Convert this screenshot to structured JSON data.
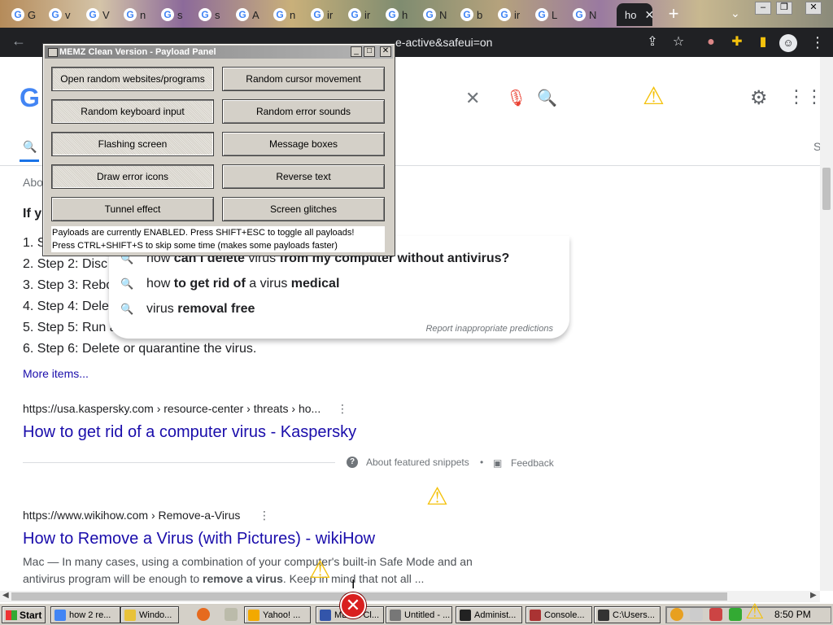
{
  "browser": {
    "tabs": [
      {
        "label": "G"
      },
      {
        "label": "v"
      },
      {
        "label": "V"
      },
      {
        "label": "n"
      },
      {
        "label": "s"
      },
      {
        "label": "s"
      },
      {
        "label": "A"
      },
      {
        "label": "n"
      },
      {
        "label": "ir"
      },
      {
        "label": "ir"
      },
      {
        "label": "h"
      },
      {
        "label": "N"
      },
      {
        "label": "b"
      },
      {
        "label": "ir"
      },
      {
        "label": "L"
      },
      {
        "label": "N"
      }
    ],
    "active_tab": "ho",
    "close_glyph": "✕",
    "new_tab_glyph": "+",
    "url_fragment": "e-active&safeui=on",
    "window_controls": [
      "–",
      "❐",
      "✕"
    ]
  },
  "google": {
    "logo_text": "G",
    "about_text": "Abo",
    "heading_text": "If y",
    "s_tab": "S",
    "steps": [
      "1. S",
      "2. Step 2: Disc",
      "3. Step 3: Rebo",
      "4. Step 4: Dele",
      "5. Step 5: Run a",
      "6. Step 6: Delete or quarantine the virus."
    ],
    "more_items": "More items...",
    "autocomplete": [
      {
        "pre": "how ",
        "bold": "can i delete",
        "mid": " virus ",
        "bold2": "from my computer without antivirus?"
      },
      {
        "pre": "how ",
        "bold": "to get rid of",
        "mid": " a virus ",
        "bold2": "medical"
      },
      {
        "pre": "virus ",
        "bold": "removal free",
        "mid": "",
        "bold2": ""
      }
    ],
    "report_predictions": "Report inappropriate predictions",
    "result1": {
      "url": "https://usa.kaspersky.com › resource-center › threats › ho...",
      "title": "How to get rid of a computer virus - Kaspersky"
    },
    "featured": {
      "about": "About featured snippets",
      "dot": "•",
      "feedback": "Feedback"
    },
    "result2": {
      "url": "https://www.wikihow.com › Remove-a-Virus",
      "title": "How to Remove a Virus (with Pictures) - wikiHow",
      "snippet_pre": "Mac — In many cases, using a combination of your computer's built-in Safe Mode and an antivirus program will be enough to ",
      "snippet_bold": "remove a virus",
      "snippet_post": ". Keep in mind that not all ..."
    }
  },
  "memz": {
    "title": "MEMZ Clean Version - Payload Panel",
    "buttons": [
      {
        "label": "Open random websites/programs",
        "enabled": true
      },
      {
        "label": "Random cursor movement",
        "enabled": false
      },
      {
        "label": "Random keyboard input",
        "enabled": true
      },
      {
        "label": "Random error sounds",
        "enabled": false
      },
      {
        "label": "Flashing screen",
        "enabled": true
      },
      {
        "label": "Message boxes",
        "enabled": false
      },
      {
        "label": "Draw error icons",
        "enabled": true
      },
      {
        "label": "Reverse text",
        "enabled": false
      },
      {
        "label": "Tunnel effect",
        "enabled": false
      },
      {
        "label": "Screen glitches",
        "enabled": false
      }
    ],
    "status1": "Payloads are currently ENABLED. Press SHIFT+ESC to toggle all payloads!",
    "status2": "Press CTRL+SHIFT+S to skip some time (makes some payloads faster)",
    "controls": [
      "_",
      "□",
      "✕"
    ]
  },
  "taskbar": {
    "start": "Start",
    "buttons": [
      {
        "label": "how 2 re...",
        "color": "#4285f4"
      },
      {
        "label": "Windo...",
        "color": "#e8c23a"
      },
      {
        "label": "Yahoo! ...",
        "color": "#f2a900"
      },
      {
        "label": "MEMZ Cl...",
        "color": "#3355aa"
      },
      {
        "label": "Untitled - ...",
        "color": "#777"
      },
      {
        "label": "Administ...",
        "color": "#222"
      },
      {
        "label": "Console...",
        "color": "#a33"
      },
      {
        "label": "C:\\Users...",
        "color": "#333"
      }
    ],
    "clock": "8:50 PM"
  },
  "colors": {
    "link": "#1a0dab",
    "warning": "#f4c20d",
    "error": "#d91f1f"
  }
}
